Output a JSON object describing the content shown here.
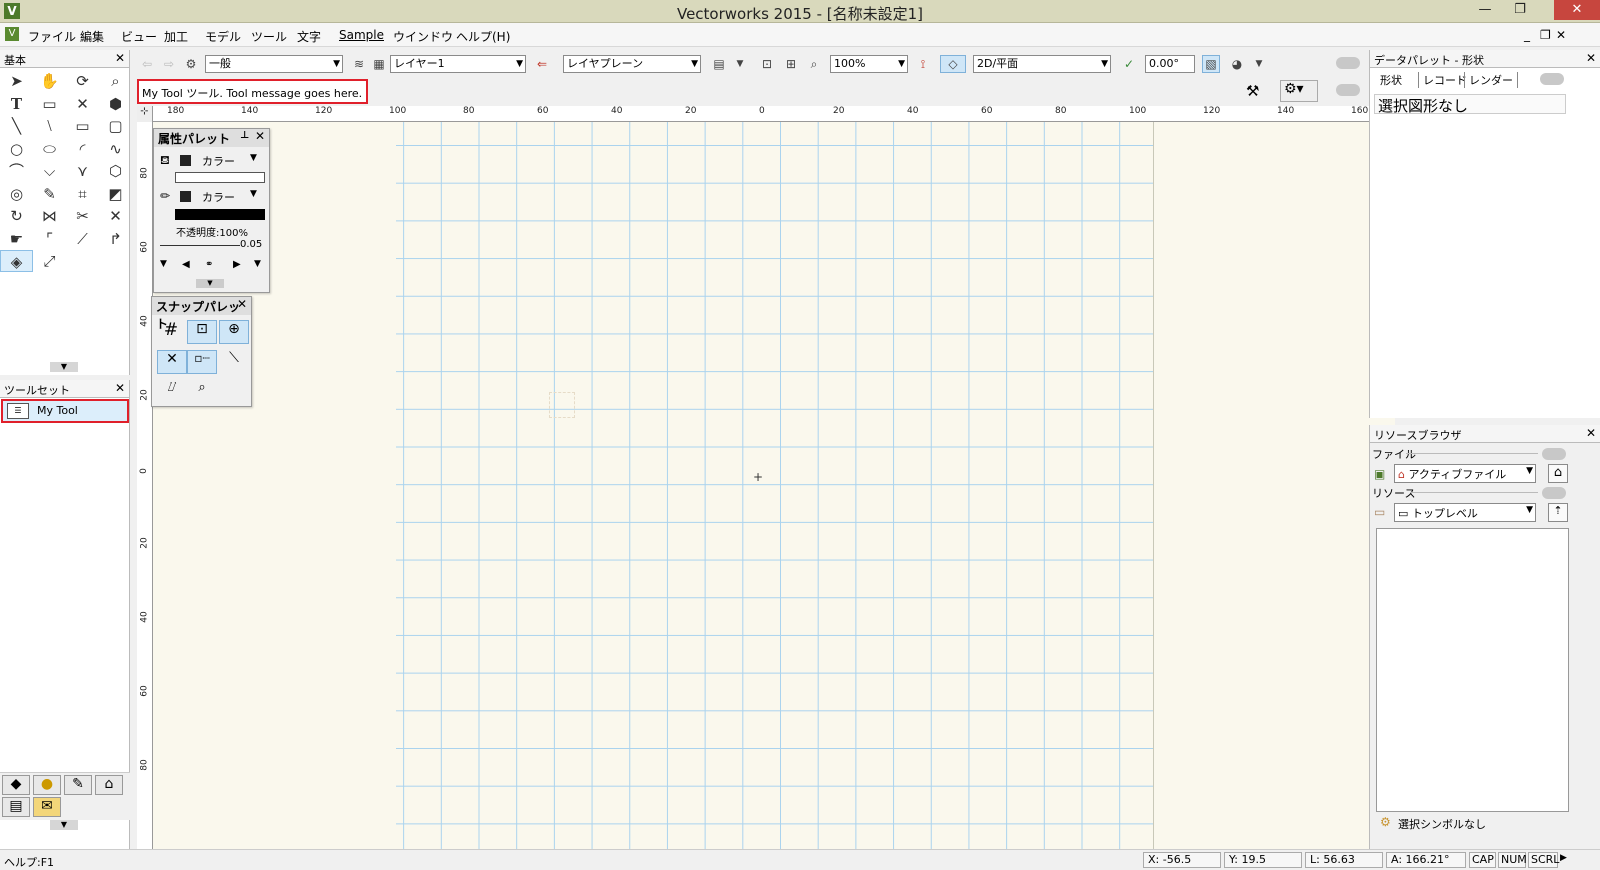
{
  "window": {
    "title": "Vectorworks 2015 - [名称未設定1]"
  },
  "menubar": {
    "items": [
      "ファイル",
      "編集",
      "ビュー",
      "加工",
      "モデル",
      "ツール",
      "文字",
      "Sample",
      "ウインドウ",
      "ヘルプ(H)"
    ]
  },
  "toolbar": {
    "class_value": "一般",
    "layer_value": "レイヤー1",
    "plane_value": "レイヤプレーン",
    "zoom_value": "100%",
    "view_value": "2D/平面",
    "angle_value": "0.00°"
  },
  "tool_message": "My Tool ツール. Tool message goes here.",
  "basic_palette": {
    "title": "基本"
  },
  "toolset_palette": {
    "title": "ツールセット",
    "selected_tool": "My Tool"
  },
  "attr_palette": {
    "title": "属性パレット",
    "fill_label": "カラー",
    "pen_label": "カラー",
    "opacity": "不透明度:100%",
    "line_weight": "0.05"
  },
  "snap_palette": {
    "title": "スナップパレット"
  },
  "ruler": {
    "h_labels": [
      "180",
      "140",
      "120",
      "100",
      "80",
      "60",
      "40",
      "20",
      "0",
      "20",
      "40",
      "60",
      "80",
      "100",
      "120",
      "140",
      "160"
    ],
    "v_labels": [
      "80",
      "60",
      "40",
      "20",
      "0",
      "20",
      "40",
      "60",
      "80"
    ]
  },
  "data_palette": {
    "title": "データパレット - 形状",
    "tabs": [
      "形状",
      "レコード",
      "レンダー"
    ],
    "selection": "選択図形なし"
  },
  "resource_browser": {
    "title": "リソースブラウザ",
    "file_label": "ファイル",
    "file_value": "アクティブファイル",
    "resource_label": "リソース",
    "resource_value": "トップレベル",
    "symbol_status": "選択シンボルなし"
  },
  "status": {
    "help": "ヘルプ:F1",
    "x": "X: -56.5",
    "y": "Y: 19.5",
    "l": "L: 56.63",
    "a": "A: 166.21°",
    "cap": "CAP",
    "num": "NUM",
    "scrl": "SCRL"
  },
  "colors": {
    "highlight": "#e0202b",
    "grid": "#aad3ee",
    "canvas": "#faf8ed",
    "title_bg": "#d9d9bc"
  }
}
